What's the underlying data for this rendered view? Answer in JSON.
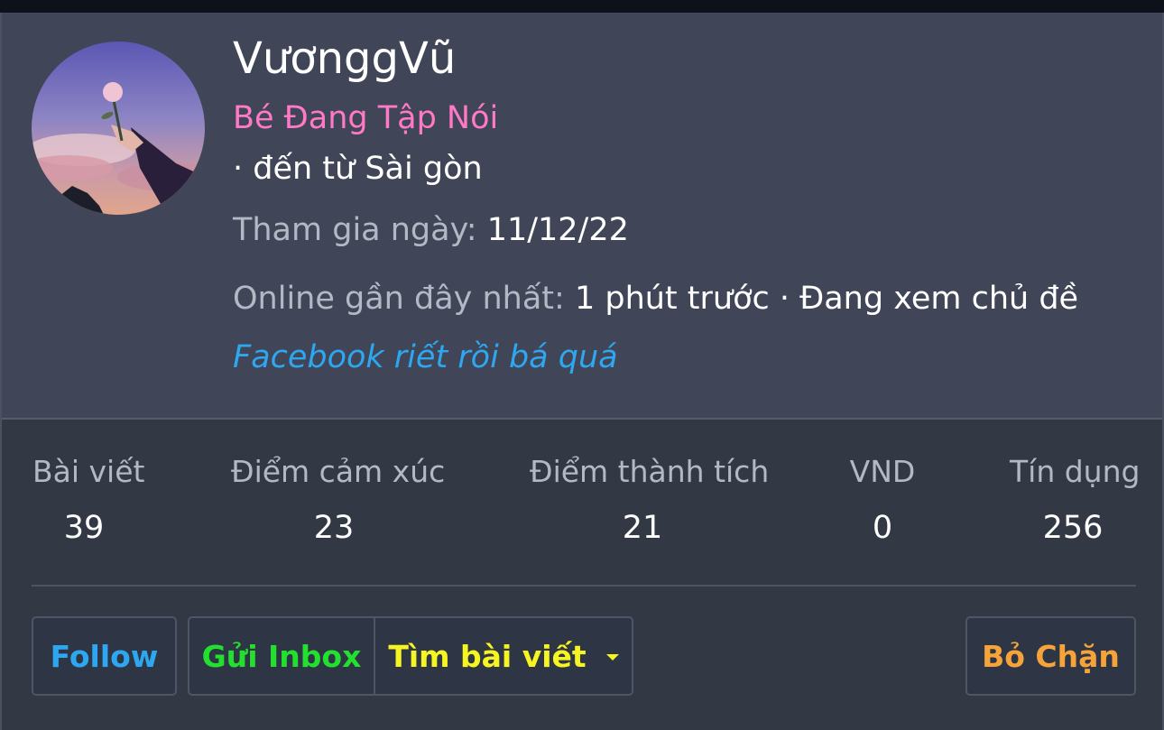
{
  "profile": {
    "username": "VươnggVũ",
    "user_title": "Bé Đang Tập Nói",
    "location": "· đến từ Sài gòn",
    "joined_label": "Tham gia ngày: ",
    "joined_value": "11/12/22",
    "last_seen_label": "Online gần đây nhất: ",
    "last_seen_value": "1 phút trước · Đang xem chủ đề",
    "custom_title": "Facebook riết rồi bá quá"
  },
  "stats": [
    {
      "label": "Bài viết",
      "value": "39"
    },
    {
      "label": "Điểm cảm xúc",
      "value": "23"
    },
    {
      "label": "Điểm thành tích",
      "value": "21"
    },
    {
      "label": "VND",
      "value": "0"
    },
    {
      "label": "Tín dụng",
      "value": "256"
    }
  ],
  "actions": {
    "follow": "Follow",
    "inbox": "Gửi Inbox",
    "find_posts": "Tìm bài viết",
    "unblock": "Bỏ Chặn"
  },
  "colors": {
    "card_bg": "#333845",
    "header_bg": "#404657",
    "user_title": "#ff79c6",
    "custom_title": "#2ea7f1",
    "follow": "#2ea7f1",
    "inbox": "#22e02d",
    "find_posts": "#f6f421",
    "unblock": "#f6a33a"
  },
  "icons": {
    "avatar": "avatar-image-hand-holding-rose",
    "dropdown": "caret-down-icon"
  }
}
